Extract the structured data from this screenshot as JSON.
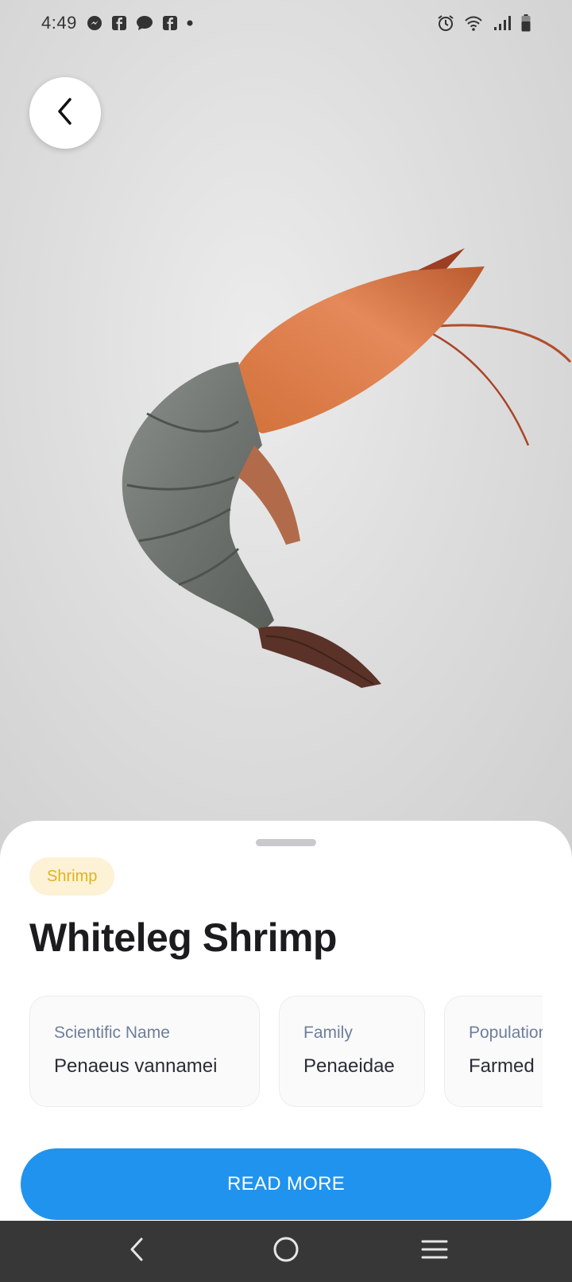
{
  "status_bar": {
    "time": "4:49",
    "left_icons": [
      "messenger-icon",
      "facebook-icon",
      "chat-bubble-icon",
      "facebook-icon",
      "dot-icon"
    ],
    "right_icons": [
      "alarm-icon",
      "wifi-icon",
      "signal-icon",
      "battery-icon"
    ]
  },
  "species": {
    "category": "Shrimp",
    "common_name": "Whiteleg Shrimp",
    "facts": [
      {
        "label": "Scientific Name",
        "value": "Penaeus vannamei"
      },
      {
        "label": "Family",
        "value": "Penaeidae"
      },
      {
        "label": "Population",
        "value": "Farmed"
      }
    ]
  },
  "actions": {
    "read_more_label": "READ MORE"
  },
  "colors": {
    "accent": "#1f93ee",
    "chip_bg": "#fdf1d6",
    "chip_text": "#e0b41c",
    "nav_bar": "#373737"
  }
}
